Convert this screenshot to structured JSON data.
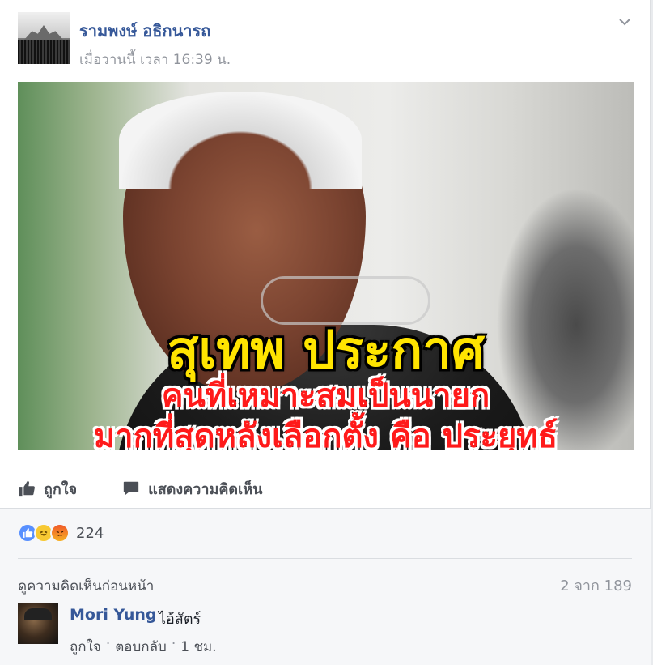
{
  "post": {
    "author": "รามพงษ์ อธิกนารถ",
    "timestamp": "เมื่อวานนี้ เวลา 16:39 น.",
    "image_text": {
      "line1": "สุเทพ ประกาศ",
      "line2": "คนที่เหมาะสมเป็นนายก",
      "line3": "มากที่สุดหลังเลือกตั้ง คือ ประยุทธ์"
    }
  },
  "actions": {
    "like_label": "ถูกใจ",
    "comment_label": "แสดงความคิดเห็น"
  },
  "reactions": {
    "types": [
      "like",
      "haha",
      "angry"
    ],
    "count": "224"
  },
  "comments": {
    "view_previous": "ดูความคิดเห็นก่อนหน้า",
    "count_text": "2 จาก 189",
    "items": [
      {
        "name": "Mori Yung",
        "text": "ไอ้สัตร์",
        "like": "ถูกใจ",
        "reply": "ตอบกลับ",
        "time": "1 ชม."
      }
    ]
  },
  "colors": {
    "link": "#365899",
    "muted": "#90949c",
    "like_blue": "#5890ff",
    "headline_yellow": "#ffe400",
    "headline_red": "#ff1a1a"
  }
}
